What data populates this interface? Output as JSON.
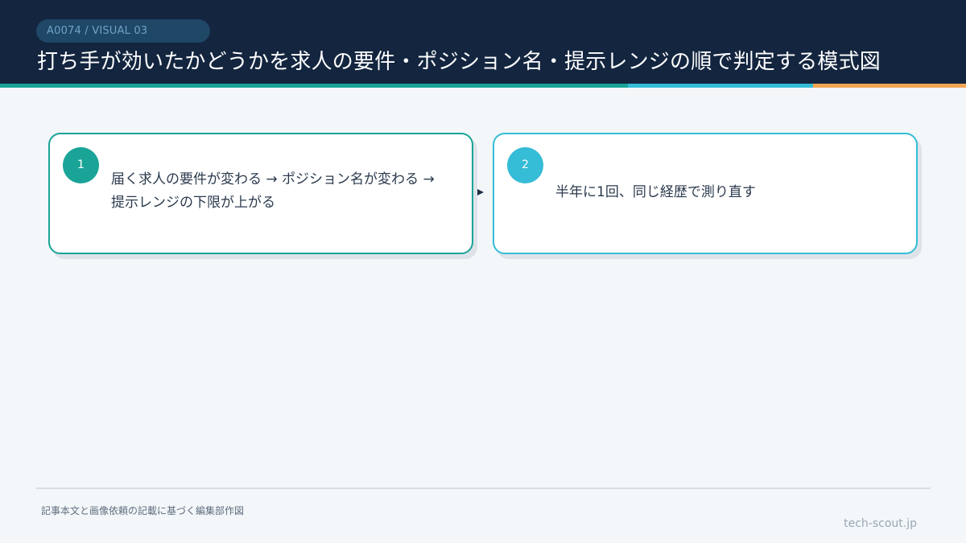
{
  "header": {
    "tag": "A0074 / VISUAL 03",
    "title": "打ち手が効いたかどうかを求人の要件・ポジション名・提示レンジの順で判定する模式図"
  },
  "steps": [
    {
      "number": "1",
      "line1": "届く求人の要件が変わる → ポジション名が変わる →",
      "line2": "提示レンジの下限が上がる"
    },
    {
      "number": "2",
      "text": "半年に1回、同じ経歴で測り直す"
    }
  ],
  "footer": {
    "note": "記事本文と画像依頼の記載に基づく編集部作図",
    "site": "tech-scout.jp"
  },
  "colors": {
    "header_bg": "#13253f",
    "teal": "#1aa497",
    "cyan": "#35bcd6",
    "orange": "#f2a552"
  }
}
